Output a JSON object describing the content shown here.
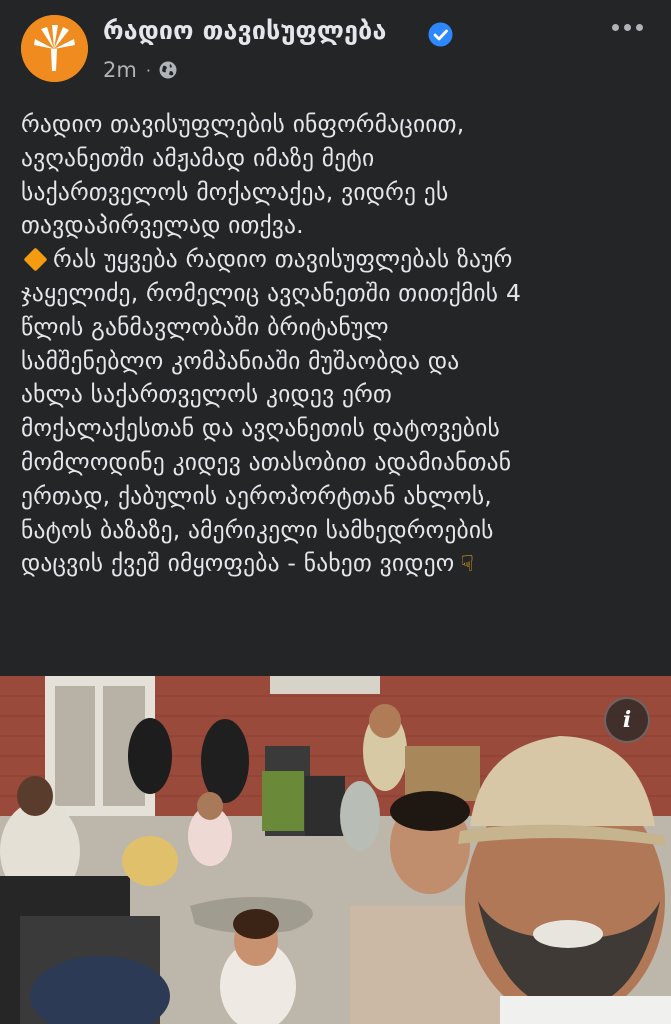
{
  "page": {
    "name": "რადიო თავისუფლება",
    "time": "2m",
    "separator": "·",
    "privacy_icon": "globe-icon",
    "more_icon": "more-dots-icon",
    "verified_icon": "verified-badge-icon",
    "brand_color": "#f08c1f",
    "verified_color": "#2d88ff"
  },
  "post": {
    "lines": [
      "რადიო თავისუფლების ინფორმაციით,",
      "ავღანეთში ამჟამად იმაზე მეტი",
      "საქართველოს მოქალაქეა, ვიდრე ეს",
      "თავდაპირველად ითქვა.",
      "რას უყვება რადიო თავისუფლებას ზაურ",
      "ჯაყელიძე, რომელიც ავღანეთში თითქმის 4",
      "წლის განმავლობაში ბრიტანულ",
      "სამშენებლო კომპანიაში მუშაობდა და",
      "ახლა საქართველოს კიდევ ერთ",
      "მოქალაქესთან და ავღანეთის დატოვების",
      "მომლოდინე კიდევ ათასობით ადამიანთან",
      "ერთად, ქაბულის აეროპორტთან ახლოს,",
      "ნატოს ბაზაზე, ამერიკელი სამხედროების",
      "დაცვის ქვეშ იმყოფება - ნახეთ ვიდეო"
    ],
    "bullet_icon": "orange-diamond-icon",
    "pointing_icon": "pointing-down-hand-icon"
  },
  "media": {
    "info_label": "i",
    "info_icon": "info-icon"
  }
}
